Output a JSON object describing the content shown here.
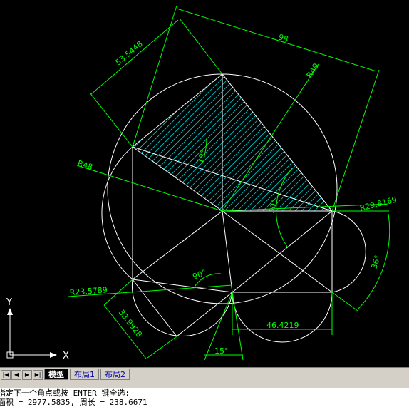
{
  "drawing": {
    "dimensions": [
      {
        "id": "d98",
        "text": "98"
      },
      {
        "id": "d53",
        "text": "53.5448"
      },
      {
        "id": "dR49",
        "text": "R49"
      },
      {
        "id": "dR48",
        "text": "R48"
      },
      {
        "id": "d18",
        "text": "18°"
      },
      {
        "id": "d30",
        "text": "30°"
      },
      {
        "id": "dR29",
        "text": "R29.8169"
      },
      {
        "id": "d36",
        "text": "36°"
      },
      {
        "id": "d90",
        "text": "90°"
      },
      {
        "id": "dR23",
        "text": "R23.5789"
      },
      {
        "id": "d33",
        "text": "33.9928"
      },
      {
        "id": "d46",
        "text": "46.4219"
      },
      {
        "id": "d15",
        "text": "15°"
      }
    ],
    "ucs": {
      "x_label": "X",
      "y_label": "Y"
    },
    "colors": {
      "geometry": "#ffffff",
      "dimension": "#00ff00",
      "hatch": "#00c8c8",
      "background": "#000000"
    }
  },
  "layout_tabs": {
    "nav": [
      "|◀",
      "◀",
      "▶",
      "▶|"
    ],
    "tabs": [
      {
        "label": "模型",
        "active": true
      },
      {
        "label": "布局1",
        "active": false
      },
      {
        "label": "布局2",
        "active": false
      }
    ]
  },
  "command": {
    "line1": "指定下一个角点或按 ENTER 键全选:",
    "line2": "面积 = 2977.5835, 周长 = 238.6671"
  }
}
